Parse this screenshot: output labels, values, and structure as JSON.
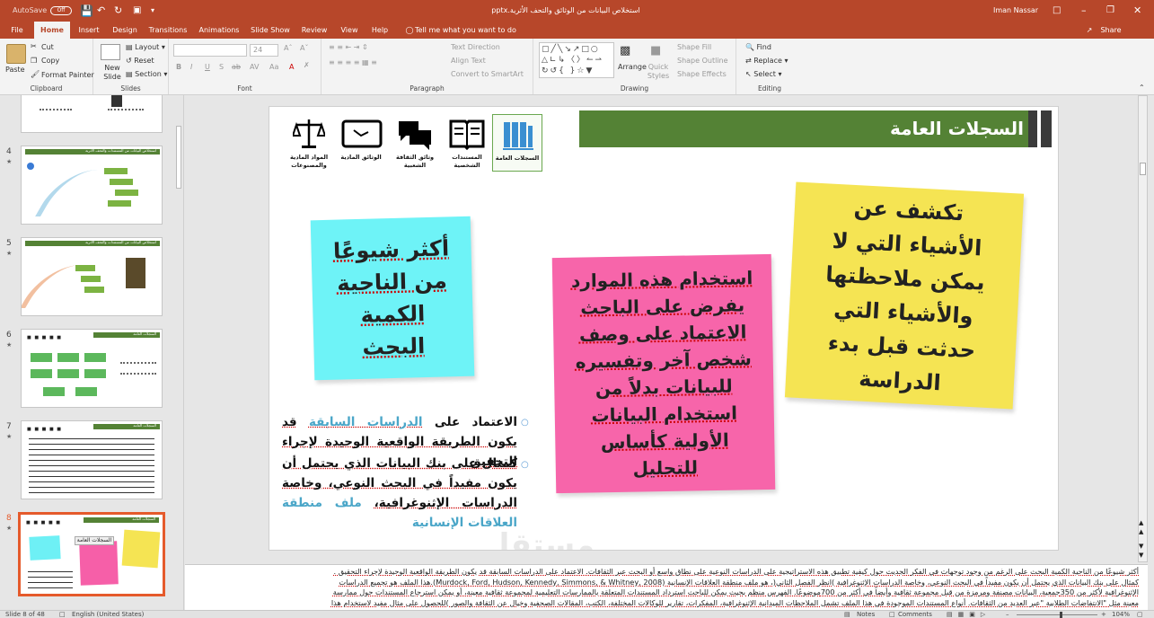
{
  "titlebar": {
    "autosave_label": "AutoSave",
    "autosave_state": "Off",
    "filename": "استخلاص البيانات من الوثائق والتحف الأثرية.pptx",
    "user": "Iman Nassar"
  },
  "tabs": [
    "File",
    "Home",
    "Insert",
    "Design",
    "Transitions",
    "Animations",
    "Slide Show",
    "Review",
    "View",
    "Help"
  ],
  "tell_me": "Tell me what you want to do",
  "share": "Share",
  "ribbon": {
    "clipboard": {
      "paste": "Paste",
      "cut": "Cut",
      "copy": "Copy",
      "format_painter": "Format Painter",
      "label": "Clipboard"
    },
    "slides": {
      "new_slide": "New Slide",
      "layout": "Layout",
      "reset": "Reset",
      "section": "Section",
      "label": "Slides"
    },
    "font": {
      "size": "24",
      "label": "Font"
    },
    "paragraph": {
      "text_direction": "Text Direction",
      "align_text": "Align Text",
      "smartart": "Convert to SmartArt",
      "label": "Paragraph"
    },
    "drawing": {
      "arrange": "Arrange",
      "quick_styles": "Quick Styles",
      "shape_fill": "Shape Fill",
      "shape_outline": "Shape Outline",
      "shape_effects": "Shape Effects",
      "label": "Drawing"
    },
    "editing": {
      "find": "Find",
      "replace": "Replace",
      "select": "Select",
      "label": "Editing"
    }
  },
  "thumbnails": [
    {
      "num": "4",
      "title": "استخلاص البيانات من المستندات والتحف الأثرية"
    },
    {
      "num": "5",
      "title": "استخلاص البيانات من المستندات والتحف الأثرية"
    },
    {
      "num": "6",
      "title": "السجلات العامة"
    },
    {
      "num": "7",
      "title": "السجلات العامة"
    },
    {
      "num": "8",
      "title": "السجلات العامة"
    }
  ],
  "slide": {
    "title": "السجلات العامة",
    "icons": [
      {
        "name": "records",
        "label": "السجلات العامة"
      },
      {
        "name": "book",
        "label": "المستندات الشخصية"
      },
      {
        "name": "chat",
        "label": "وثائق الثقافة الشعبية"
      },
      {
        "name": "tablet",
        "label": "الوثائق المادية"
      },
      {
        "name": "scale",
        "label": "المواد المادية والمصنوعات"
      }
    ],
    "note_cyan": "أكثر شيوعًا من الناحية الكمية البحث",
    "note_pink": "استخدام هذه الموارد يفرض على الباحث الاعتماد على وصف شخص آخر وتفسيره للبيانات بدلاً من استخدام البيانات الأولية كأساس للتحليل",
    "note_yellow": "تكشف عن الأشياء التي لا يمكن ملاحظتها والأشياء التي حدثت قبل بدء الدراسة",
    "bullet1_a": "الاعتماد على",
    "bullet1_hl": "الدراسات السابقة",
    "bullet1_b": "قد يكون الطريقة الواقعية الوحيدة لإجراء التحقيق",
    "bullet2_a": "كمثال على بنك البيانات الذي يحتمل أن يكون مفيداً في البحث النوعي، وخاصة الدراسات الإثنوغرافية،",
    "bullet2_hl": "ملف منطقة العلاقات الإنسانية",
    "watermark": "مستقل"
  },
  "notes_lines": [
    "أكثر شيوعًا من الناحية الكمية البحث على الرغم من وجود توجهات في الفكر الجديث حول كيفية تطبيق هذه الاستراتيجية على الدراسات النوعية على نطاق واسع أو البحث عبر الثقافات. الاعتماد على الدراسات السابقة قد يكون الطريقة الواقعية الوحيدة لإجراء التحقيق .",
    "كمثال على بنك البيانات الذي يحتمل أن يكون مفيداً في البحث النوعي، وخاصة الدراسات الإثنوغرافية )انظر الفصل الثاني(، هو ملف منطقة العلاقات الإنسانية (Murdock, Ford, Hudson, Kennedy, Simmons, & Whitney, 2008).هذا الملف هو تجميع الدراسات",
    "الإثنوغرافية لأكثر من 350جمعية، البيانات مصنفة ومرمزة من قبل مجموعة ثقافية وأيضاً في أكثر من 700موضوعًا. الفهرس منظم بحيث يمكن للباحث استرداد المستندات المتعلقة بالممارسات التعليمية لمجموعة ثقافية معينة، أو يمكن استرجاع المستندات حول ممارسة",
    "معينة مثل \"الانتفاضات الطلابية \"عبر العديد من الثقافات. أنواع المستندات الموجودة في هذا الملف تشمل الملاحظات الميدانية الإثنوغرافية، المفكرات، تقارير للوكالات المختلفة، الكتب، المقالات الصحفية وخيال عن الثقافة والصور )للحصول على مثال مفيد لاستخدام هذا"
  ],
  "status": {
    "slide_of": "Slide 8 of 48",
    "language": "English (United States)",
    "notes": "Notes",
    "comments": "Comments",
    "zoom": "104%"
  }
}
